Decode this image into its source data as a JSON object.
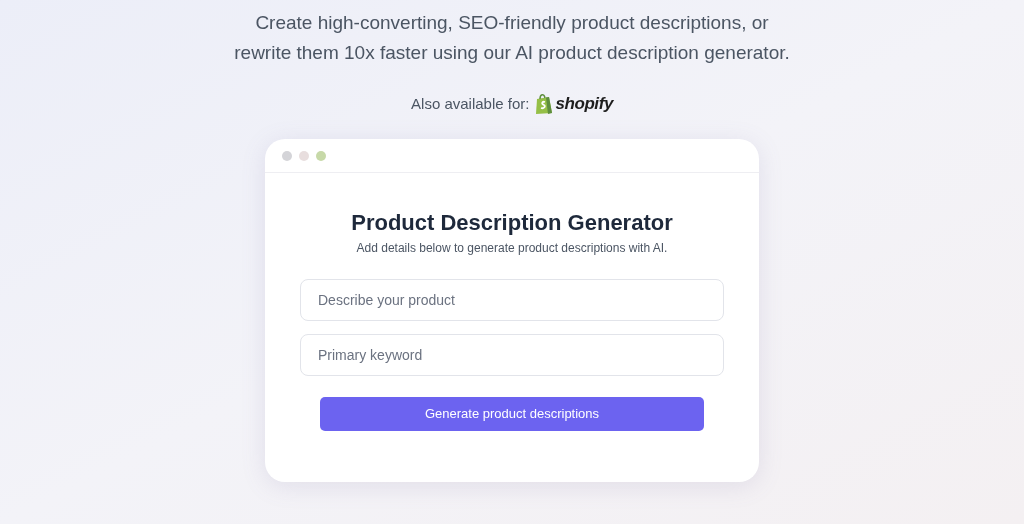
{
  "hero": {
    "lines": [
      "Create high-converting, SEO-friendly product descriptions, or",
      "rewrite them 10x faster using our AI product description generator."
    ]
  },
  "availability": {
    "label": "Also available for:",
    "platform": "shopify"
  },
  "card": {
    "title": "Product Description Generator",
    "subtitle": "Add details below to generate product descriptions with AI.",
    "fields": [
      {
        "placeholder": "Describe your product"
      },
      {
        "placeholder": "Primary keyword"
      }
    ],
    "button": "Generate product descriptions"
  }
}
